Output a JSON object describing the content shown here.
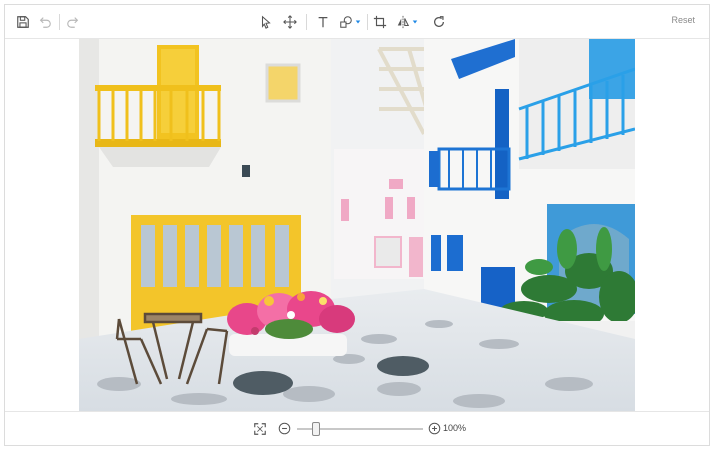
{
  "toolbar": {
    "save_icon": "save-icon",
    "undo_icon": "undo-icon",
    "redo_icon": "redo-icon",
    "select_icon": "pointer-icon",
    "pan_icon": "move-icon",
    "text_icon": "text-icon",
    "shapes_icon": "shapes-icon",
    "crop_icon": "crop-icon",
    "flip_icon": "flip-icon",
    "rotate_icon": "rotate-icon",
    "reset_label": "Reset"
  },
  "image": {
    "description_icon": "photo-santorini-street"
  },
  "footer": {
    "fit_icon": "fit-screen-icon",
    "zoom_out_icon": "zoom-out-icon",
    "zoom_in_icon": "zoom-in-icon",
    "zoom_level": "100%",
    "zoom_fraction": 0.15
  },
  "colors": {
    "accent": "#1e88e5",
    "icon": "#555555",
    "disabled_icon": "#b8b8b8"
  }
}
